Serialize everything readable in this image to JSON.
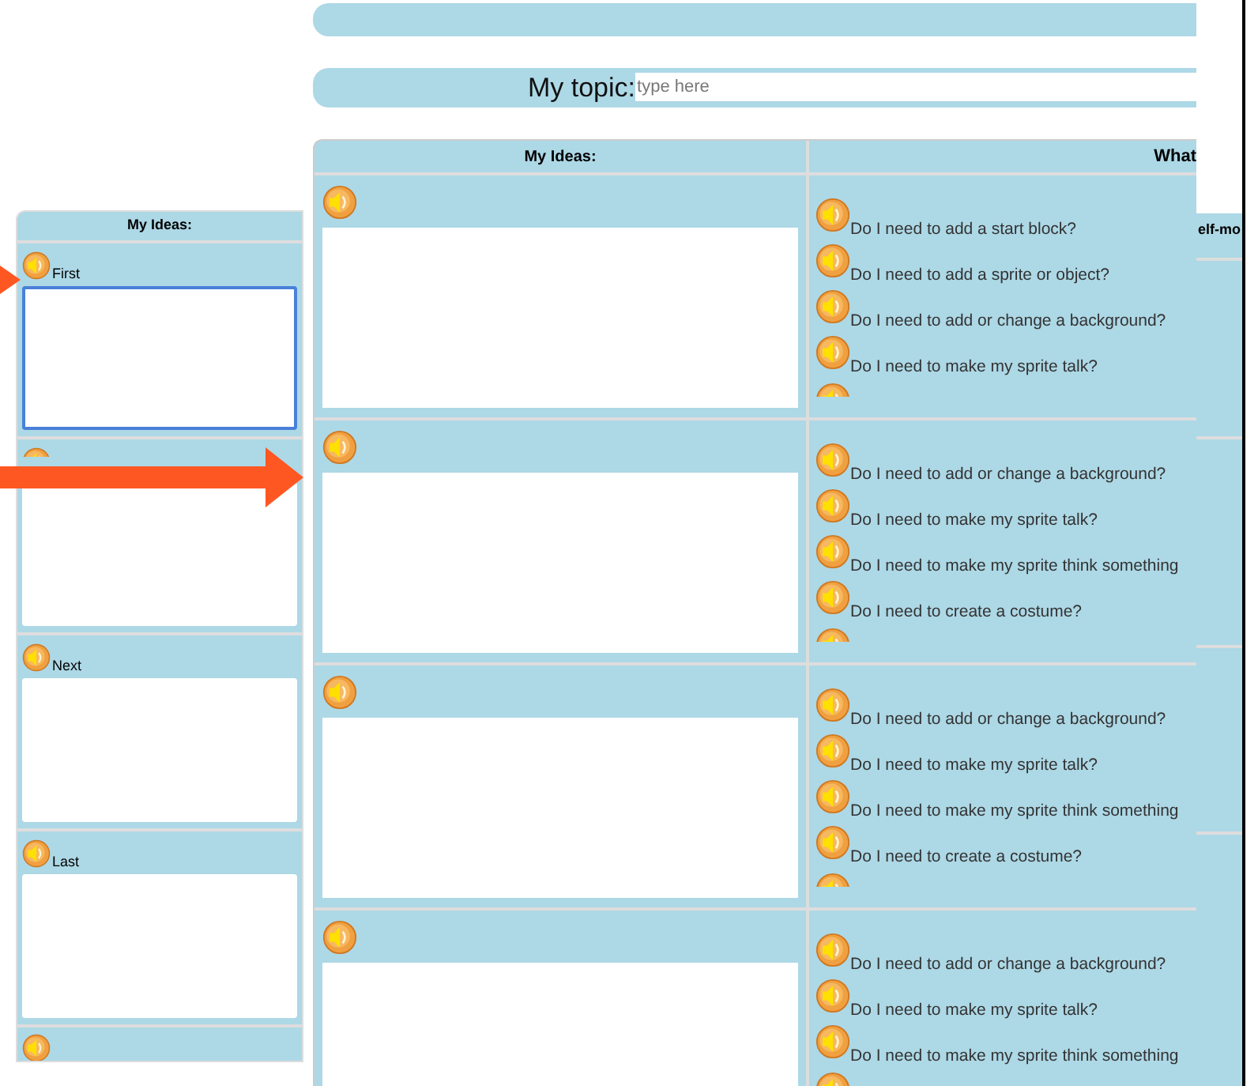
{
  "topic": {
    "label": "My topic:",
    "placeholder": "type here"
  },
  "left_panel": {
    "header": "My Ideas:",
    "sections": [
      {
        "label": "First",
        "focused": true
      },
      {
        "focused": false
      },
      {
        "label": "Next",
        "focused": false
      },
      {
        "label": "Last",
        "focused": false
      }
    ]
  },
  "main_panel": {
    "columns": [
      "My Ideas:",
      "What"
    ],
    "rows": [
      {
        "questions": [
          "Do I need to add a start block?",
          "Do I need to add a sprite or object?",
          "Do I need to add or change a background?",
          "Do I need to make my sprite talk?"
        ]
      },
      {
        "questions": [
          "Do I need to add or change a background?",
          "Do I need to make my sprite talk?",
          "Do I need to make my sprite think something",
          "Do I need to create a costume?"
        ]
      },
      {
        "questions": [
          "Do I need to add or change a background?",
          "Do I need to make my sprite talk?",
          "Do I need to make my sprite think something",
          "Do I need to create a costume?"
        ]
      },
      {
        "questions": [
          "Do I need to add or change a background?",
          "Do I need to make my sprite talk?",
          "Do I need to make my sprite think something"
        ]
      }
    ]
  },
  "back_panel": {
    "header": "elf-mo"
  }
}
